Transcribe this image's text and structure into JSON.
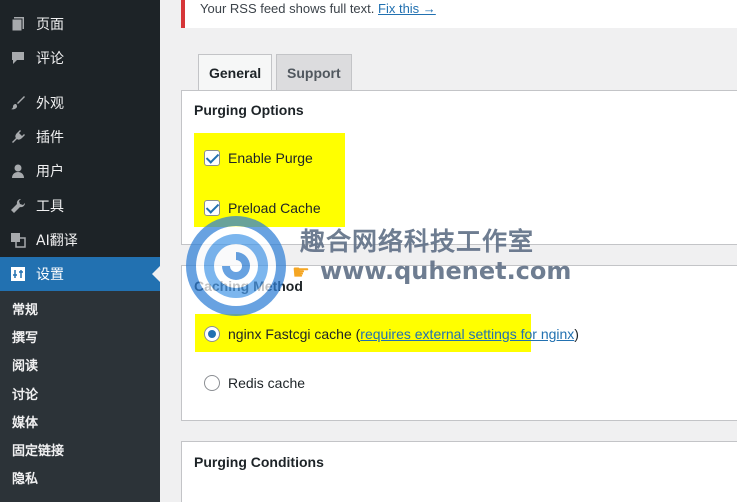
{
  "sidebar": {
    "items": [
      {
        "label": "页面",
        "icon": "page-icon"
      },
      {
        "label": "评论",
        "icon": "comment-icon"
      },
      {
        "label": "外观",
        "icon": "brush-icon"
      },
      {
        "label": "插件",
        "icon": "plugin-icon"
      },
      {
        "label": "用户",
        "icon": "user-icon"
      },
      {
        "label": "工具",
        "icon": "wrench-icon"
      },
      {
        "label": "AI翻译",
        "icon": "translate-icon"
      },
      {
        "label": "设置",
        "icon": "settings-icon"
      }
    ],
    "submenu": [
      "常规",
      "撰写",
      "阅读",
      "讨论",
      "媒体",
      "固定链接",
      "隐私"
    ]
  },
  "notice": {
    "text": "Your RSS feed shows full text.",
    "link": "Fix this →"
  },
  "tabs": [
    {
      "label": "General"
    },
    {
      "label": "Support"
    }
  ],
  "purging_options": {
    "title": "Purging Options",
    "enable_purge": "Enable Purge",
    "preload_cache": "Preload Cache"
  },
  "caching_method": {
    "title": "Caching Method",
    "nginx_label": "nginx Fastcgi cache (",
    "nginx_link": "requires external settings for nginx",
    "nginx_close": ")",
    "redis_label": "Redis cache"
  },
  "purging_conditions": {
    "title": "Purging Conditions"
  },
  "watermark": {
    "title": "趣合网络科技工作室",
    "url": "www.quhenet.com"
  },
  "colors": {
    "sidebar_bg": "#1d2327",
    "accent": "#2271b1",
    "highlight": "#ffff00",
    "notice_border": "#d63638"
  }
}
